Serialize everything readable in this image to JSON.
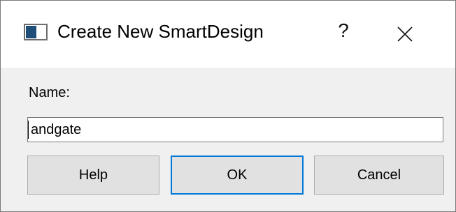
{
  "window": {
    "title": "Create New SmartDesign",
    "help_glyph": "?",
    "icons": {
      "app": "window-app-icon",
      "help": "question-mark-icon",
      "close": "close-x-icon"
    }
  },
  "form": {
    "name_label": "Name:",
    "name_value": "andgate"
  },
  "buttons": {
    "help": "Help",
    "ok": "OK",
    "cancel": "Cancel"
  },
  "colors": {
    "titlebar": "#ffffff",
    "body": "#f0f0f0",
    "button_face": "#e1e1e1",
    "default_button_border": "#0078d7",
    "icon_accent": "#1f4e79"
  }
}
